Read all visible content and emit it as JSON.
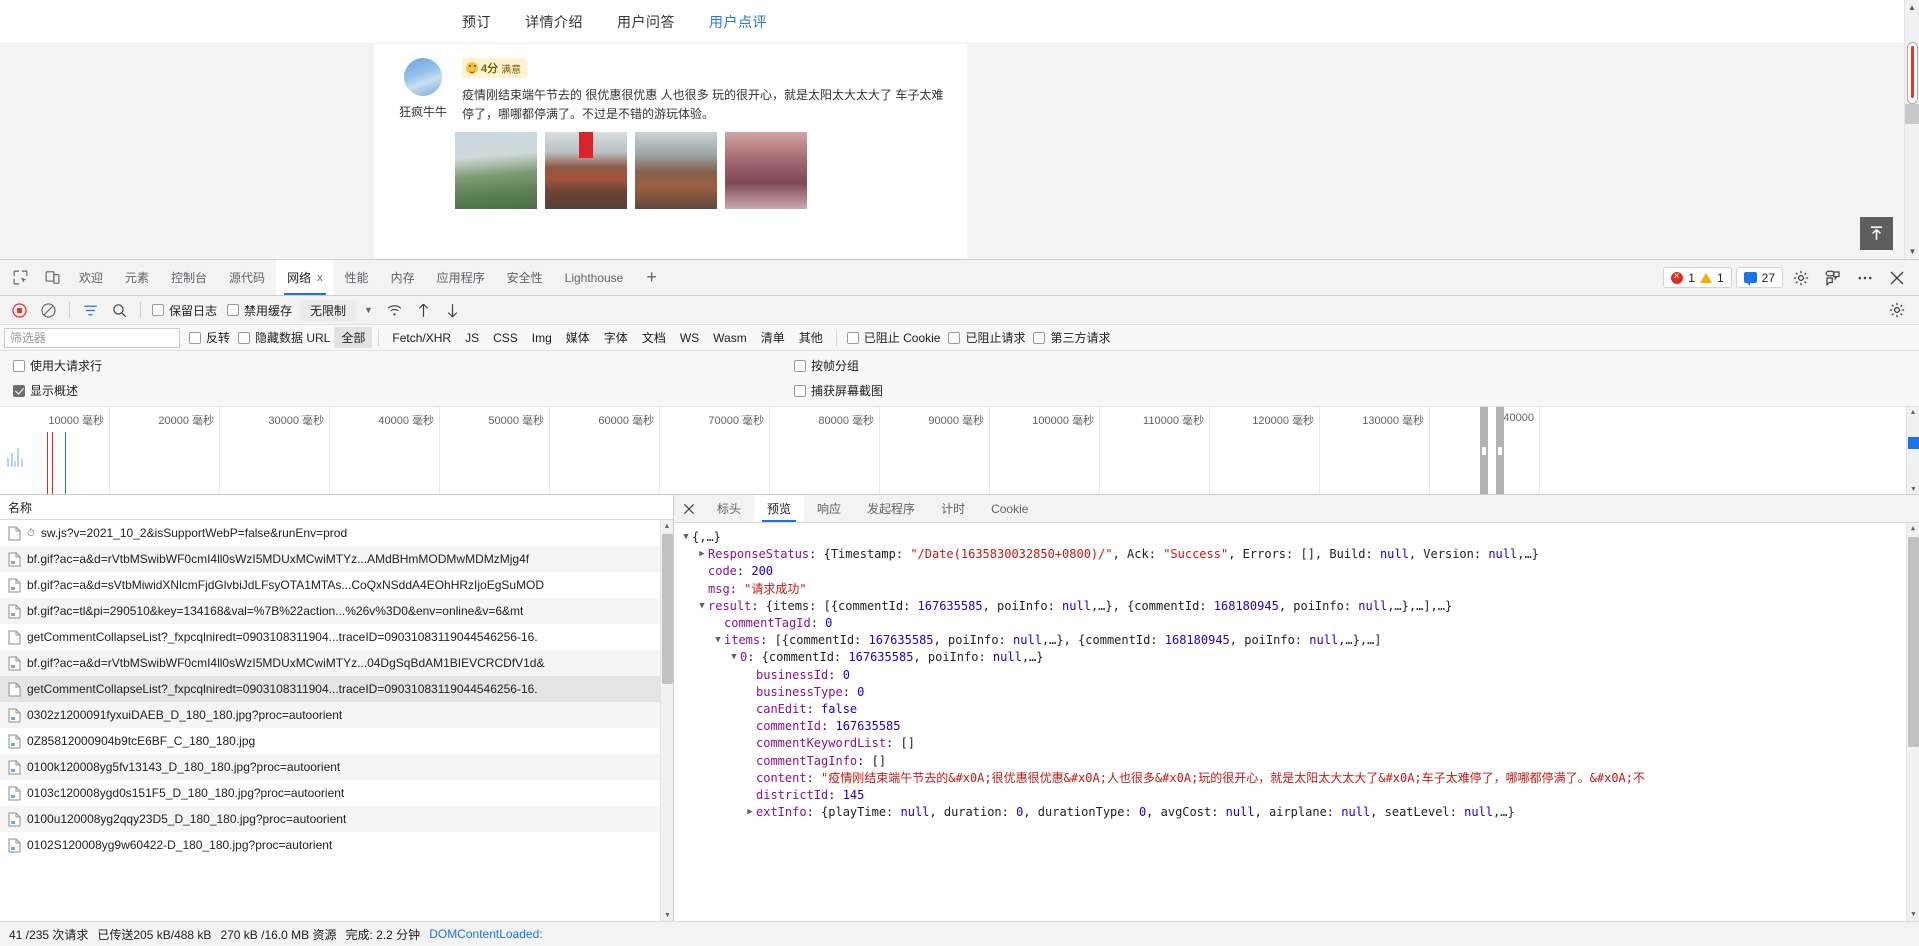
{
  "webpage": {
    "nav_tabs": [
      {
        "label": "预订",
        "active": false
      },
      {
        "label": "详情介绍",
        "active": false
      },
      {
        "label": "用户问答",
        "active": false
      },
      {
        "label": "用户点评",
        "active": true
      }
    ],
    "review": {
      "username": "狂疯牛牛",
      "score": "4分",
      "score_label": "满意",
      "text": "疫情刚结束端午节去的 很优惠很优惠 人也很多 玩的很开心，就是太阳太大太大了 车子太难停了，哪哪都停满了。不过是不错的游玩体验。",
      "photo_count": 4
    },
    "back_to_top_icon": "arrow-up-to-line-icon"
  },
  "devtools": {
    "tabs": [
      {
        "label": "欢迎",
        "active": false,
        "closable": false
      },
      {
        "label": "元素",
        "active": false,
        "closable": false
      },
      {
        "label": "控制台",
        "active": false,
        "closable": false
      },
      {
        "label": "源代码",
        "active": false,
        "closable": false
      },
      {
        "label": "网络",
        "active": true,
        "closable": true
      },
      {
        "label": "性能",
        "active": false,
        "closable": false
      },
      {
        "label": "内存",
        "active": false,
        "closable": false
      },
      {
        "label": "应用程序",
        "active": false,
        "closable": false
      },
      {
        "label": "安全性",
        "active": false,
        "closable": false
      },
      {
        "label": "Lighthouse",
        "active": false,
        "closable": false
      }
    ],
    "tab_close_label": "x",
    "add_tab_label": "+",
    "inspect_icon": "inspect-element-icon",
    "device_icon": "device-toolbar-icon",
    "counters": {
      "errors": "1",
      "warnings": "1",
      "messages": "27"
    },
    "header_icons": {
      "settings": "gear-icon",
      "customize": "feedback-icon",
      "more": "more-options-icon",
      "close": "close-icon"
    },
    "network_toolbar": {
      "record_icon": "record-stop-icon",
      "clear_icon": "clear-no-entry-icon",
      "filter_icon": "filter-funnel-icon",
      "search_icon": "search-icon",
      "preserve_log": {
        "label": "保留日志",
        "checked": false
      },
      "disable_cache": {
        "label": "禁用缓存",
        "checked": false
      },
      "throttling": "无限制",
      "caret_icon": "chevron-down-icon",
      "wifi_icon": "network-conditions-icon",
      "import_icon": "import-har-icon",
      "export_icon": "export-har-icon",
      "settings_icon": "gear-icon"
    },
    "filter_row": {
      "placeholder": "筛选器",
      "value": "",
      "invert": {
        "label": "反转",
        "checked": false
      },
      "hide_data_urls": {
        "label": "隐藏数据 URL",
        "checked": false
      },
      "types": [
        {
          "label": "全部",
          "active": true
        },
        {
          "label": "Fetch/XHR",
          "active": false
        },
        {
          "label": "JS",
          "active": false
        },
        {
          "label": "CSS",
          "active": false
        },
        {
          "label": "Img",
          "active": false
        },
        {
          "label": "媒体",
          "active": false
        },
        {
          "label": "字体",
          "active": false
        },
        {
          "label": "文档",
          "active": false
        },
        {
          "label": "WS",
          "active": false
        },
        {
          "label": "Wasm",
          "active": false
        },
        {
          "label": "清单",
          "active": false
        },
        {
          "label": "其他",
          "active": false
        }
      ],
      "blocked_cookies": {
        "label": "已阻止 Cookie",
        "checked": false
      },
      "blocked_requests": {
        "label": "已阻止请求",
        "checked": false
      },
      "third_party": {
        "label": "第三方请求",
        "checked": false
      }
    },
    "settings_rows": {
      "big_request_rows": {
        "label": "使用大请求行",
        "checked": false
      },
      "group_by_frame": {
        "label": "按帧分组",
        "checked": false
      },
      "show_overview": {
        "label": "显示概述",
        "checked": true
      },
      "capture_screenshots": {
        "label": "捕获屏幕截图",
        "checked": false
      }
    },
    "overview": {
      "unit": "毫秒",
      "ticks": [
        10000,
        20000,
        30000,
        40000,
        50000,
        60000,
        70000,
        80000,
        90000,
        100000,
        110000,
        120000,
        130000,
        140000
      ],
      "tick_labels": [
        "10000 毫秒",
        "20000 毫秒",
        "30000 毫秒",
        "40000 毫秒",
        "50000 毫秒",
        "60000 毫秒",
        "70000 毫秒",
        "80000 毫秒",
        "90000 毫秒",
        "100000 毫秒",
        "110000 毫秒",
        "120000 毫秒",
        "130000 毫秒",
        "140000"
      ]
    },
    "request_list": {
      "column_header": "名称",
      "rows": [
        {
          "name": "sw.js?v=2021_10_2&isSupportWebP=false&runEnv=prod",
          "icon": "script-file-icon",
          "has_clock": true,
          "selected": false
        },
        {
          "name": "bf.gif?ac=a&d=rVtbMSwibWF0cmI4ll0sWzI5MDUxMCwiMTYz...AMdBHmMODMwMDMzMjg4f",
          "icon": "image-file-icon",
          "has_clock": false,
          "selected": false
        },
        {
          "name": "bf.gif?ac=a&d=sVtbMiwidXNlcmFjdGlvbiJdLFsyOTA1MTAs...CoQxNSddA4EOhHRzIjoEgSuMOD",
          "icon": "image-file-icon",
          "has_clock": false,
          "selected": false
        },
        {
          "name": "bf.gif?ac=tl&pi=290510&key=134168&val=%7B%22action...%26v%3D0&env=online&v=6&mt",
          "icon": "image-file-icon",
          "has_clock": false,
          "selected": false
        },
        {
          "name": "getCommentCollapseList?_fxpcqlniredt=0903108311904...traceID=09031083119044546256-16.",
          "icon": "generic-file-icon",
          "has_clock": false,
          "selected": false
        },
        {
          "name": "bf.gif?ac=a&d=rVtbMSwibWF0cmI4ll0sWzI5MDUxMCwiMTYz...04DgSqBdAM1BIEVCRCDfV1d&",
          "icon": "image-file-icon",
          "has_clock": false,
          "selected": false
        },
        {
          "name": "getCommentCollapseList?_fxpcqlniredt=0903108311904...traceID=09031083119044546256-16.",
          "icon": "generic-file-icon",
          "has_clock": false,
          "selected": true
        },
        {
          "name": "0302z1200091fyxuiDAEB_D_180_180.jpg?proc=autoorient",
          "icon": "image-file-icon",
          "has_clock": false,
          "selected": false
        },
        {
          "name": "0Z85812000904b9tcE6BF_C_180_180.jpg",
          "icon": "image-file-icon",
          "has_clock": false,
          "selected": false
        },
        {
          "name": "0100k120008yg5fv13143_D_180_180.jpg?proc=autoorient",
          "icon": "image-file-icon",
          "has_clock": false,
          "selected": false
        },
        {
          "name": "0103c120008ygd0s151F5_D_180_180.jpg?proc=autoorient",
          "icon": "image-file-icon",
          "has_clock": false,
          "selected": false
        },
        {
          "name": "0100u120008yg2qqy23D5_D_180_180.jpg?proc=autoorient",
          "icon": "image-file-icon",
          "has_clock": false,
          "selected": false
        },
        {
          "name": "0102S120008yg9w60422-D_180_180.jpg?proc=autorient",
          "icon": "image-file-icon",
          "has_clock": false,
          "selected": false
        }
      ]
    },
    "detail_panel": {
      "close_icon": "close-icon",
      "tabs": [
        {
          "label": "标头",
          "active": false
        },
        {
          "label": "预览",
          "active": true
        },
        {
          "label": "响应",
          "active": false
        },
        {
          "label": "发起程序",
          "active": false
        },
        {
          "label": "计时",
          "active": false
        },
        {
          "label": "Cookie",
          "active": false
        }
      ],
      "json_lines": [
        {
          "indent": 0,
          "tri": "open",
          "parts": [
            {
              "t": "{,…}",
              "c": "jpunct"
            }
          ]
        },
        {
          "indent": 1,
          "tri": "closed",
          "parts": [
            {
              "t": "ResponseStatus",
              "c": "jkey"
            },
            {
              "t": ": ",
              "c": "jpunct"
            },
            {
              "t": "{Timestamp: ",
              "c": "jpunct"
            },
            {
              "t": "\"/Date(1635830032850+0800)/\"",
              "c": "jstr"
            },
            {
              "t": ", Ack: ",
              "c": "jpunct"
            },
            {
              "t": "\"Success\"",
              "c": "jstr"
            },
            {
              "t": ", Errors: [], Build: ",
              "c": "jpunct"
            },
            {
              "t": "null",
              "c": "jnull"
            },
            {
              "t": ", Version: ",
              "c": "jpunct"
            },
            {
              "t": "null",
              "c": "jnull"
            },
            {
              "t": ",…}",
              "c": "jpunct"
            }
          ]
        },
        {
          "indent": 1,
          "tri": "none",
          "parts": [
            {
              "t": "code",
              "c": "jkey"
            },
            {
              "t": ": ",
              "c": "jpunct"
            },
            {
              "t": "200",
              "c": "jnum"
            }
          ]
        },
        {
          "indent": 1,
          "tri": "none",
          "parts": [
            {
              "t": "msg",
              "c": "jkey"
            },
            {
              "t": ": ",
              "c": "jpunct"
            },
            {
              "t": "\"请求成功\"",
              "c": "jstr"
            }
          ]
        },
        {
          "indent": 1,
          "tri": "open",
          "parts": [
            {
              "t": "result",
              "c": "jkey"
            },
            {
              "t": ": {items: [{commentId: ",
              "c": "jpunct"
            },
            {
              "t": "167635585",
              "c": "jnum"
            },
            {
              "t": ", poiInfo: ",
              "c": "jpunct"
            },
            {
              "t": "null",
              "c": "jnull"
            },
            {
              "t": ",…}, {commentId: ",
              "c": "jpunct"
            },
            {
              "t": "168180945",
              "c": "jnum"
            },
            {
              "t": ", poiInfo: ",
              "c": "jpunct"
            },
            {
              "t": "null",
              "c": "jnull"
            },
            {
              "t": ",…},…],…}",
              "c": "jpunct"
            }
          ]
        },
        {
          "indent": 2,
          "tri": "none",
          "parts": [
            {
              "t": "commentTagId",
              "c": "jkey"
            },
            {
              "t": ": ",
              "c": "jpunct"
            },
            {
              "t": "0",
              "c": "jnum"
            }
          ]
        },
        {
          "indent": 2,
          "tri": "open",
          "parts": [
            {
              "t": "items",
              "c": "jkey"
            },
            {
              "t": ": [{commentId: ",
              "c": "jpunct"
            },
            {
              "t": "167635585",
              "c": "jnum"
            },
            {
              "t": ", poiInfo: ",
              "c": "jpunct"
            },
            {
              "t": "null",
              "c": "jnull"
            },
            {
              "t": ",…}, {commentId: ",
              "c": "jpunct"
            },
            {
              "t": "168180945",
              "c": "jnum"
            },
            {
              "t": ", poiInfo: ",
              "c": "jpunct"
            },
            {
              "t": "null",
              "c": "jnull"
            },
            {
              "t": ",…},…]",
              "c": "jpunct"
            }
          ]
        },
        {
          "indent": 3,
          "tri": "open",
          "parts": [
            {
              "t": "0",
              "c": "jkey"
            },
            {
              "t": ": {commentId: ",
              "c": "jpunct"
            },
            {
              "t": "167635585",
              "c": "jnum"
            },
            {
              "t": ", poiInfo: ",
              "c": "jpunct"
            },
            {
              "t": "null",
              "c": "jnull"
            },
            {
              "t": ",…}",
              "c": "jpunct"
            }
          ]
        },
        {
          "indent": 4,
          "tri": "none",
          "parts": [
            {
              "t": "businessId",
              "c": "jkey"
            },
            {
              "t": ": ",
              "c": "jpunct"
            },
            {
              "t": "0",
              "c": "jnum"
            }
          ]
        },
        {
          "indent": 4,
          "tri": "none",
          "parts": [
            {
              "t": "businessType",
              "c": "jkey"
            },
            {
              "t": ": ",
              "c": "jpunct"
            },
            {
              "t": "0",
              "c": "jnum"
            }
          ]
        },
        {
          "indent": 4,
          "tri": "none",
          "parts": [
            {
              "t": "canEdit",
              "c": "jkey"
            },
            {
              "t": ": ",
              "c": "jpunct"
            },
            {
              "t": "false",
              "c": "jbool"
            }
          ]
        },
        {
          "indent": 4,
          "tri": "none",
          "parts": [
            {
              "t": "commentId",
              "c": "jkey"
            },
            {
              "t": ": ",
              "c": "jpunct"
            },
            {
              "t": "167635585",
              "c": "jnum"
            }
          ]
        },
        {
          "indent": 4,
          "tri": "none",
          "parts": [
            {
              "t": "commentKeywordList",
              "c": "jkey"
            },
            {
              "t": ": []",
              "c": "jpunct"
            }
          ]
        },
        {
          "indent": 4,
          "tri": "none",
          "parts": [
            {
              "t": "commentTagInfo",
              "c": "jkey"
            },
            {
              "t": ": []",
              "c": "jpunct"
            }
          ]
        },
        {
          "indent": 4,
          "tri": "none",
          "parts": [
            {
              "t": "content",
              "c": "jkey"
            },
            {
              "t": ": ",
              "c": "jpunct"
            },
            {
              "t": "\"疫情刚结束端午节去的&#x0A;很优惠很优惠&#x0A;人也很多&#x0A;玩的很开心，就是太阳太大太大了&#x0A;车子太难停了，哪哪都停满了。&#x0A;不",
              "c": "jstr"
            }
          ]
        },
        {
          "indent": 4,
          "tri": "none",
          "parts": [
            {
              "t": "districtId",
              "c": "jkey"
            },
            {
              "t": ": ",
              "c": "jpunct"
            },
            {
              "t": "145",
              "c": "jnum"
            }
          ]
        },
        {
          "indent": 4,
          "tri": "closed",
          "parts": [
            {
              "t": "extInfo",
              "c": "jkey"
            },
            {
              "t": ": {playTime: ",
              "c": "jpunct"
            },
            {
              "t": "null",
              "c": "jnull"
            },
            {
              "t": ", duration: ",
              "c": "jpunct"
            },
            {
              "t": "0",
              "c": "jnum"
            },
            {
              "t": ", durationType: ",
              "c": "jpunct"
            },
            {
              "t": "0",
              "c": "jnum"
            },
            {
              "t": ", avgCost: ",
              "c": "jpunct"
            },
            {
              "t": "null",
              "c": "jnull"
            },
            {
              "t": ", airplane: ",
              "c": "jpunct"
            },
            {
              "t": "null",
              "c": "jnull"
            },
            {
              "t": ", seatLevel: ",
              "c": "jpunct"
            },
            {
              "t": "null",
              "c": "jnull"
            },
            {
              "t": ",…}",
              "c": "jpunct"
            }
          ]
        }
      ]
    },
    "statusbar": {
      "requests": "41 /235 次请求",
      "transferred": "已传送205 kB/488 kB",
      "resources": "270 kB /16.0 MB 资源",
      "finish": "完成: 2.2 分钟",
      "dcl": "DOMContentLoaded:"
    }
  }
}
